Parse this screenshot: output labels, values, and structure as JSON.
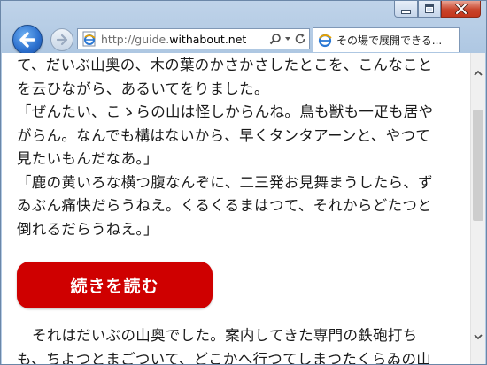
{
  "browser": {
    "address": {
      "url_prefix": "http://guide.",
      "url_domain": "withabout.net",
      "icon": "ie-page-icon"
    },
    "tab": {
      "title": "その場で展開できる..."
    },
    "icons": {
      "back": "back-arrow-icon",
      "forward": "forward-arrow-icon",
      "search": "search-icon",
      "dropdown": "chevron-down-icon",
      "refresh": "refresh-icon",
      "minimize": "minimize-icon",
      "maximize": "maximize-icon",
      "close": "close-icon"
    }
  },
  "content": {
    "paragraph1": [
      "て、だいぶ山奥の、木の葉のかさかさしたとこを、こんなこと",
      "を云ひながら、あるいてをりました。",
      "「ぜんたい、こゝらの山は怪しからんね。鳥も獣も一疋も居や",
      "がらん。なんでも構はないから、早くタンタアーンと、やつて",
      "見たいもんだなあ。」",
      "「鹿の黄いろな横つ腹なんぞに、二三発お見舞まうしたら、ず",
      "ゐぶん痛快だらうねえ。くるくるまはつて、それからどたつと",
      "倒れるだらうねえ。」"
    ],
    "read_more_label": "続きを読む",
    "paragraph2": [
      "それはだいぶの山奥でした。案内してきた専門の鉄砲打ち",
      "も、ちよつとまごついて、どこかへ行つてしまつたくらゐの山"
    ]
  },
  "colors": {
    "cta_background": "#cf0000",
    "chrome_blue": "#bfd3e9"
  }
}
